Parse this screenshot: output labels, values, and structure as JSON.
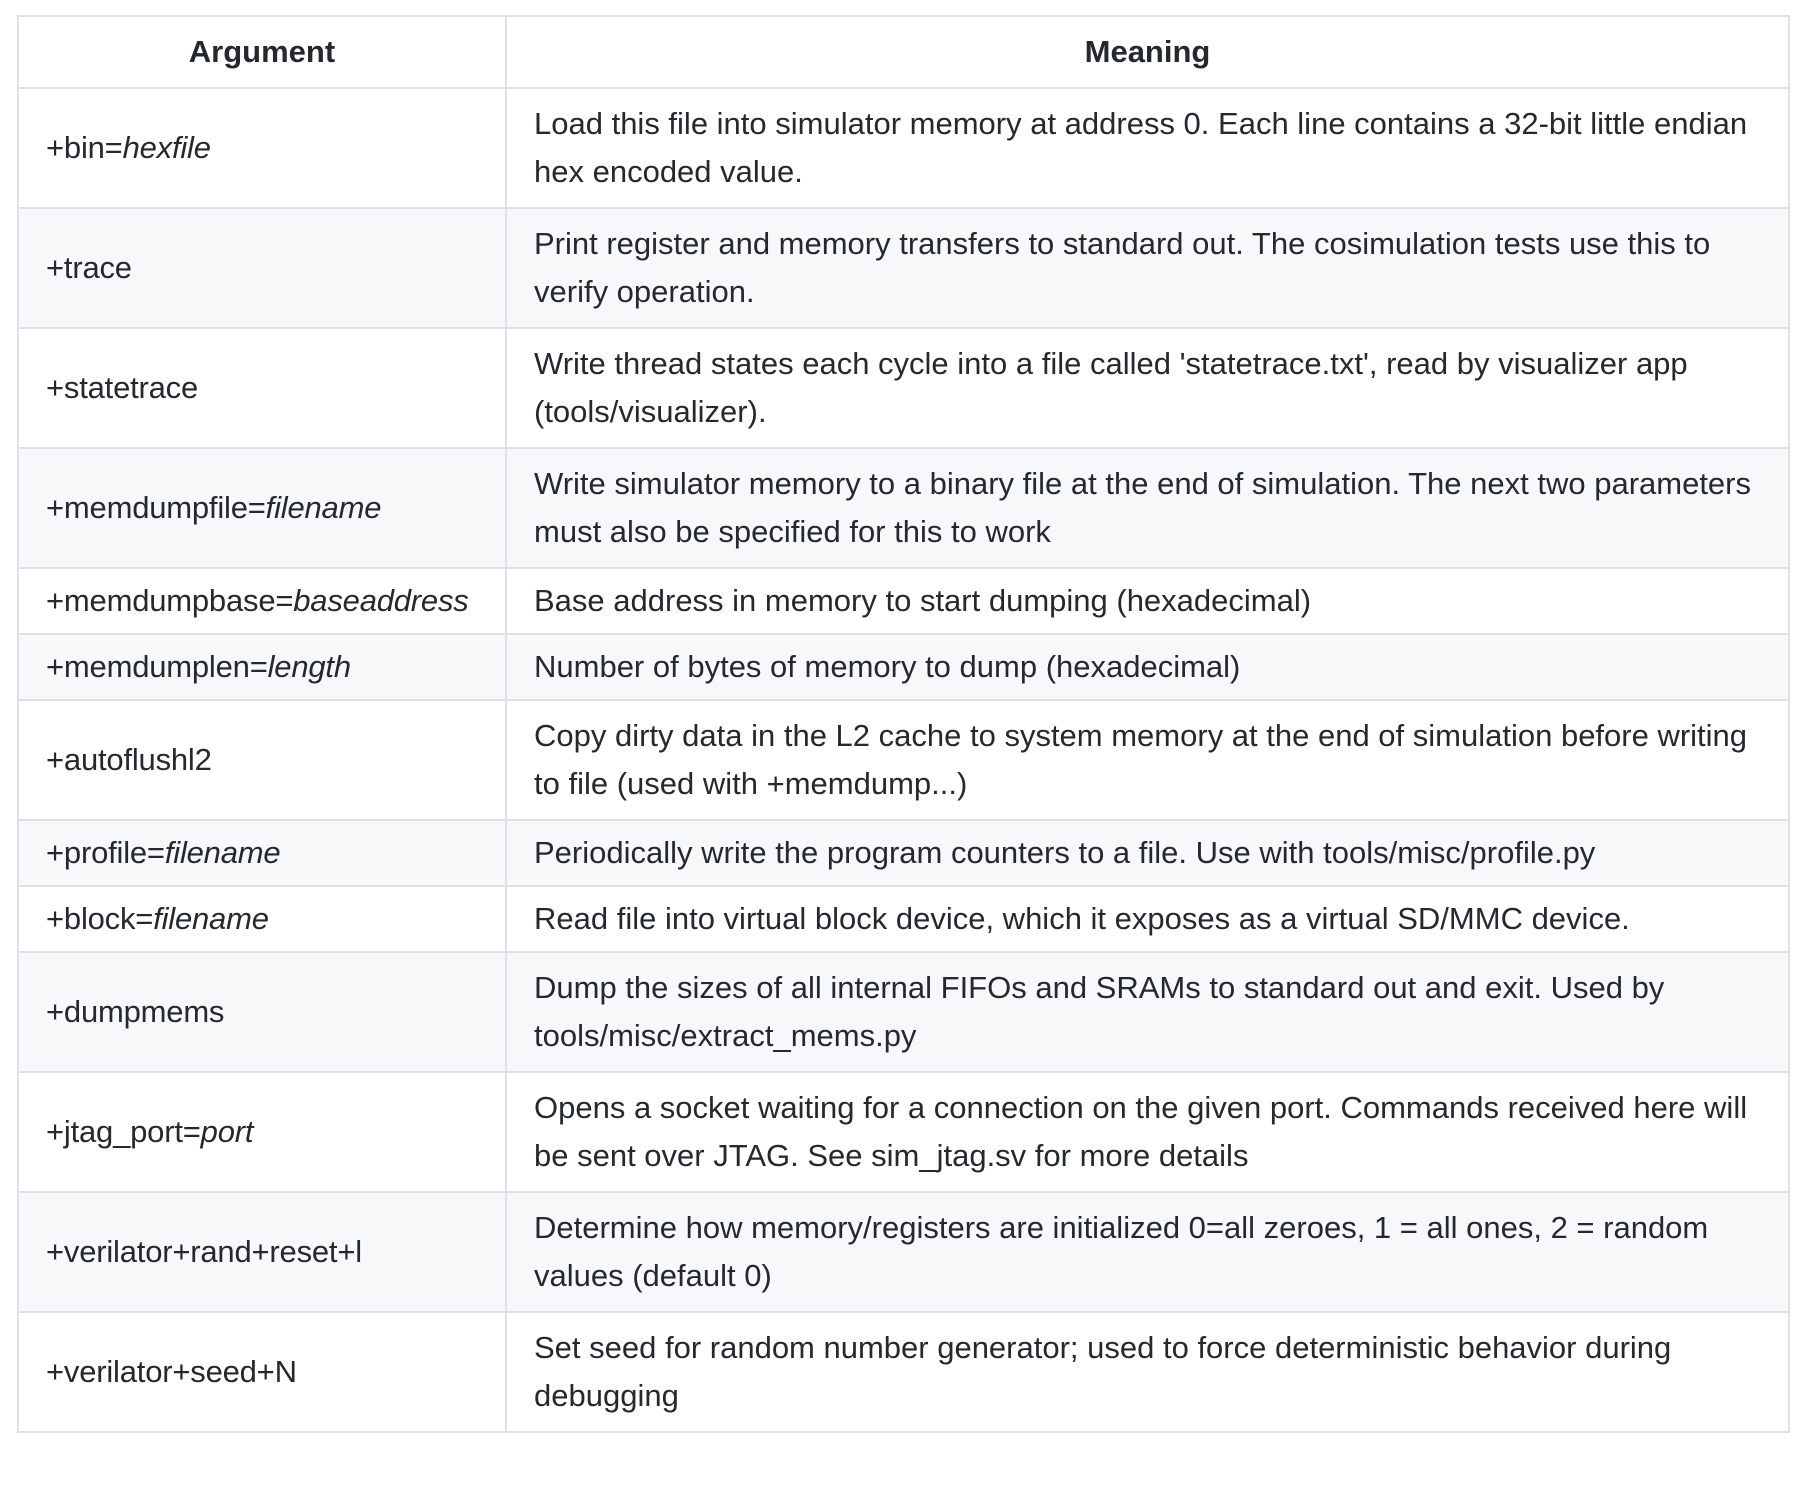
{
  "table": {
    "headers": [
      "Argument",
      "Meaning"
    ],
    "rows": [
      {
        "arg_prefix": "+bin=",
        "arg_param": "hexfile",
        "meaning": "Load this file into simulator memory at address 0. Each line contains a 32-bit little endian hex encoded value."
      },
      {
        "arg_prefix": "+trace",
        "arg_param": "",
        "meaning": "Print register and memory transfers to standard out. The cosimulation tests use this to verify operation."
      },
      {
        "arg_prefix": "+statetrace",
        "arg_param": "",
        "meaning": "Write thread states each cycle into a file called 'statetrace.txt', read by visualizer app (tools/visualizer)."
      },
      {
        "arg_prefix": "+memdumpfile=",
        "arg_param": "filename",
        "meaning": "Write simulator memory to a binary file at the end of simulation. The next two parameters must also be specified for this to work"
      },
      {
        "arg_prefix": "+memdumpbase=",
        "arg_param": "baseaddress",
        "meaning": "Base address in memory to start dumping (hexadecimal)"
      },
      {
        "arg_prefix": "+memdumplen=",
        "arg_param": "length",
        "meaning": "Number of bytes of memory to dump (hexadecimal)"
      },
      {
        "arg_prefix": "+autoflushl2",
        "arg_param": "",
        "meaning": "Copy dirty data in the L2 cache to system memory at the end of simulation before writing to file (used with +memdump...)"
      },
      {
        "arg_prefix": "+profile=",
        "arg_param": "filename",
        "meaning": "Periodically write the program counters to a file. Use with tools/misc/profile.py"
      },
      {
        "arg_prefix": "+block=",
        "arg_param": "filename",
        "meaning": "Read file into virtual block device, which it exposes as a virtual SD/MMC device."
      },
      {
        "arg_prefix": "+dumpmems",
        "arg_param": "",
        "meaning": "Dump the sizes of all internal FIFOs and SRAMs to standard out and exit. Used by tools/misc/extract_mems.py"
      },
      {
        "arg_prefix": "+jtag_port=",
        "arg_param": "port",
        "meaning": "Opens a socket waiting for a connection on the given port. Commands received here will be sent over JTAG. See sim_jtag.sv for more details"
      },
      {
        "arg_prefix": "+verilator+rand+reset+l",
        "arg_param": "",
        "meaning": "Determine how memory/registers are initialized 0=all zeroes, 1 = all ones, 2 = random values (default 0)"
      },
      {
        "arg_prefix": "+verilator+seed+N",
        "arg_param": "",
        "meaning": "Set seed for random number generator; used to force deterministic behavior during debugging"
      }
    ]
  }
}
